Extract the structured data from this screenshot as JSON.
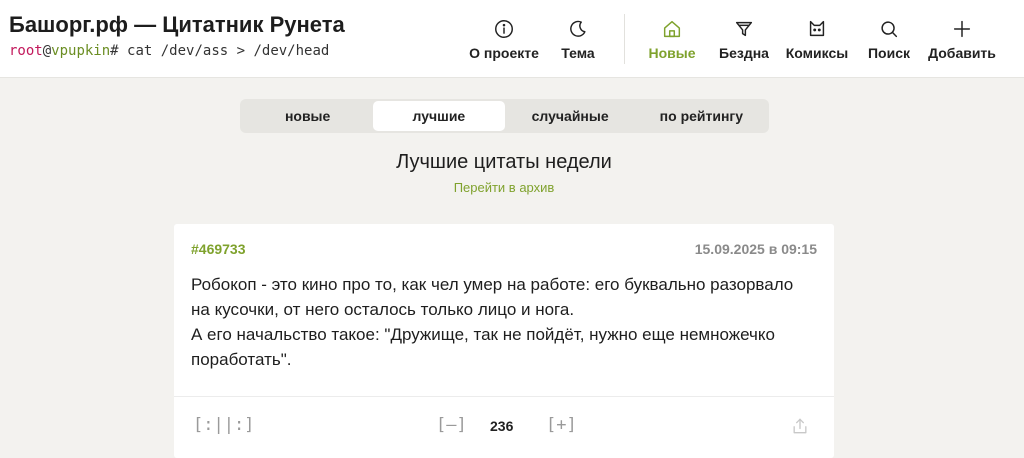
{
  "header": {
    "title": "Башорг.рф — Цитатник Рунета",
    "shell": {
      "user": "root",
      "at": "@",
      "host": "vpupkin",
      "command": "# cat /dev/ass > /dev/head"
    },
    "nav": [
      {
        "label": "О проекте",
        "icon": "info-icon"
      },
      {
        "label": "Тема",
        "icon": "moon-icon"
      },
      {
        "label": "Новые",
        "icon": "home-icon",
        "active": true
      },
      {
        "label": "Бездна",
        "icon": "funnel-icon"
      },
      {
        "label": "Комиксы",
        "icon": "cat-icon"
      },
      {
        "label": "Поиск",
        "icon": "search-icon"
      },
      {
        "label": "Добавить",
        "icon": "plus-icon"
      }
    ]
  },
  "tabs": [
    {
      "label": "новые"
    },
    {
      "label": "лучшие",
      "active": true
    },
    {
      "label": "случайные"
    },
    {
      "label": "по рейтингу"
    }
  ],
  "main": {
    "title": "Лучшие цитаты недели",
    "archive_link": "Перейти в архив"
  },
  "quote": {
    "id": "#469733",
    "date": "15.09.2025 в 09:15",
    "lines": [
      "Робокоп - это кино про то, как чел умер на работе: его буквально разорвало на кусочки, от него осталось только лицо и нога.",
      "А его начальство такое: \"Дружище, так не пойдёт, нужно еще немножечко поработать\"."
    ],
    "actions": {
      "bayan": "[:||:]",
      "minus": "[–]",
      "plus": "[+]",
      "rating": "236"
    }
  },
  "colors": {
    "accent": "#7fa22d",
    "background": "#f3f2ef",
    "card": "#ffffff",
    "username": "#c2185b"
  }
}
